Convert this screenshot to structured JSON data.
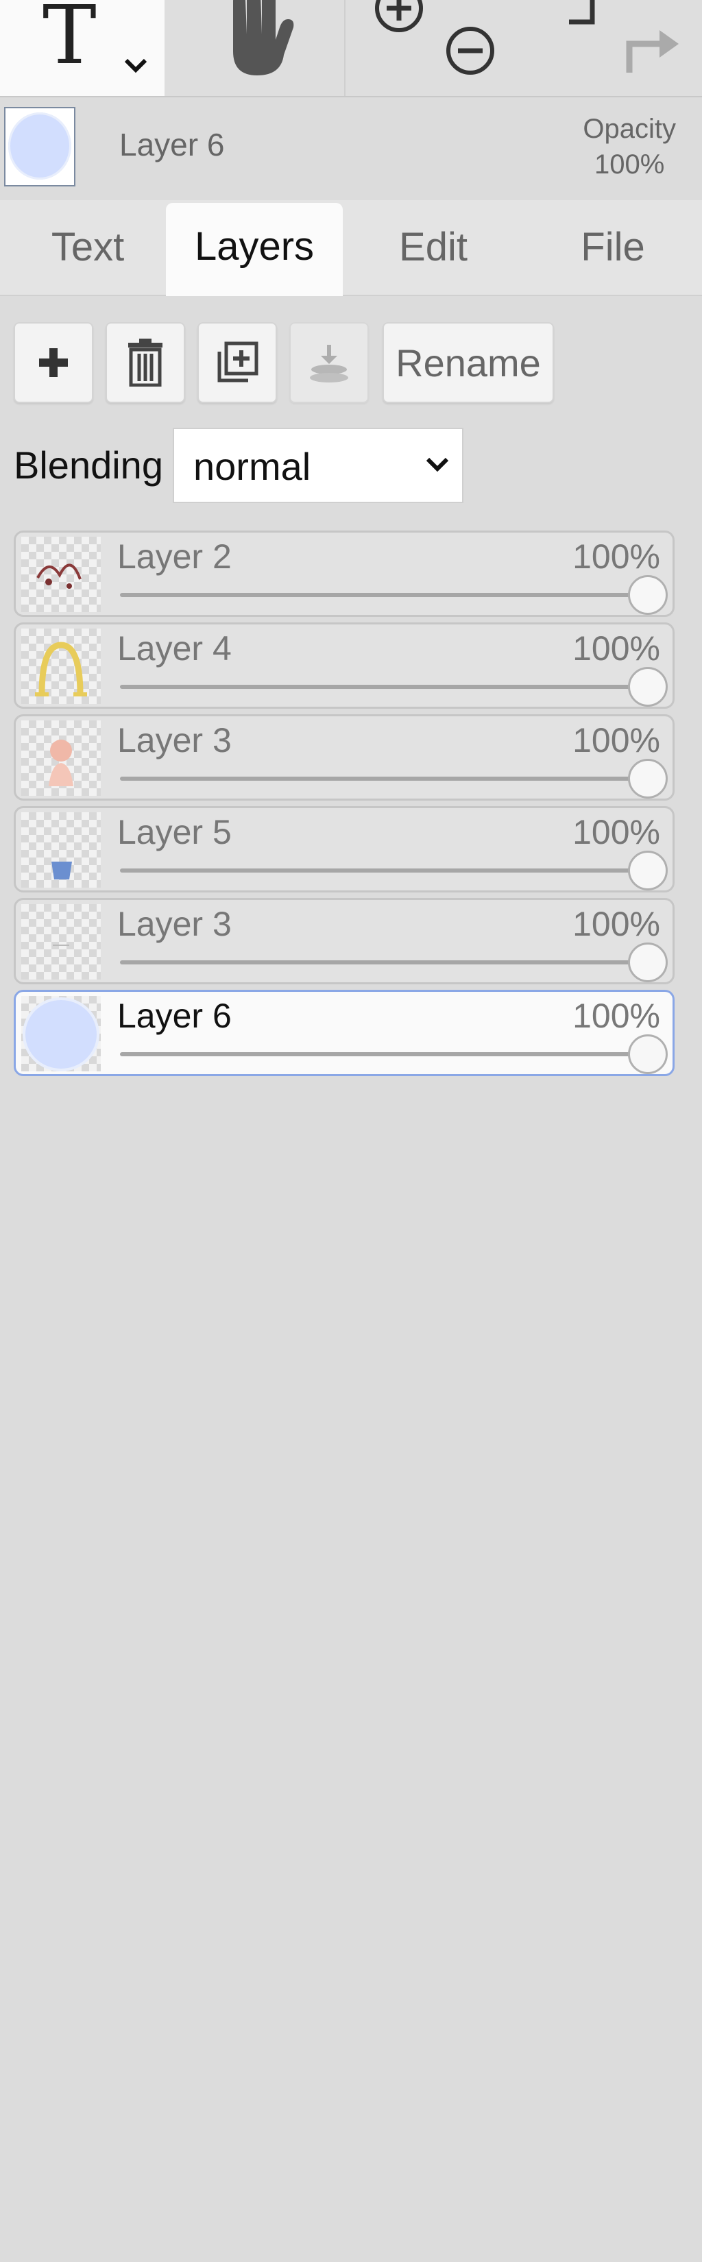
{
  "toolbar": {
    "tools": [
      {
        "name": "text-tool",
        "icon": "text-T-icon"
      },
      {
        "name": "hand-tool",
        "icon": "hand-icon"
      },
      {
        "name": "zoom",
        "icons": [
          "zoom-in-icon",
          "zoom-out-icon"
        ]
      },
      {
        "name": "history",
        "icons": [
          "undo-icon",
          "redo-icon"
        ]
      }
    ]
  },
  "header": {
    "current_layer": "Layer 6",
    "opacity_label": "Opacity",
    "opacity_value": "100%"
  },
  "tabs": [
    {
      "label": "Text",
      "active": false
    },
    {
      "label": "Layers",
      "active": true
    },
    {
      "label": "Edit",
      "active": false
    },
    {
      "label": "File",
      "active": false
    }
  ],
  "layer_buttons": {
    "add_icon": "plus-icon",
    "delete_icon": "trash-icon",
    "duplicate_icon": "duplicate-icon",
    "merge_down_icon": "merge-down-icon",
    "rename_label": "Rename"
  },
  "blending": {
    "label": "Blending",
    "value": "normal"
  },
  "layers": [
    {
      "name": "Layer 2",
      "opacity": "100%",
      "opacity_fraction": 1.0,
      "selected": false
    },
    {
      "name": "Layer 4",
      "opacity": "100%",
      "opacity_fraction": 1.0,
      "selected": false
    },
    {
      "name": "Layer 3",
      "opacity": "100%",
      "opacity_fraction": 1.0,
      "selected": false
    },
    {
      "name": "Layer 5",
      "opacity": "100%",
      "opacity_fraction": 1.0,
      "selected": false
    },
    {
      "name": "Layer 3",
      "opacity": "100%",
      "opacity_fraction": 1.0,
      "selected": false
    },
    {
      "name": "Layer 6",
      "opacity": "100%",
      "opacity_fraction": 1.0,
      "selected": true
    }
  ],
  "colors": {
    "selection_border": "#8aa7e6",
    "active_tab_bg": "#fbfbfb",
    "panel_bg": "#dcdcdc"
  }
}
